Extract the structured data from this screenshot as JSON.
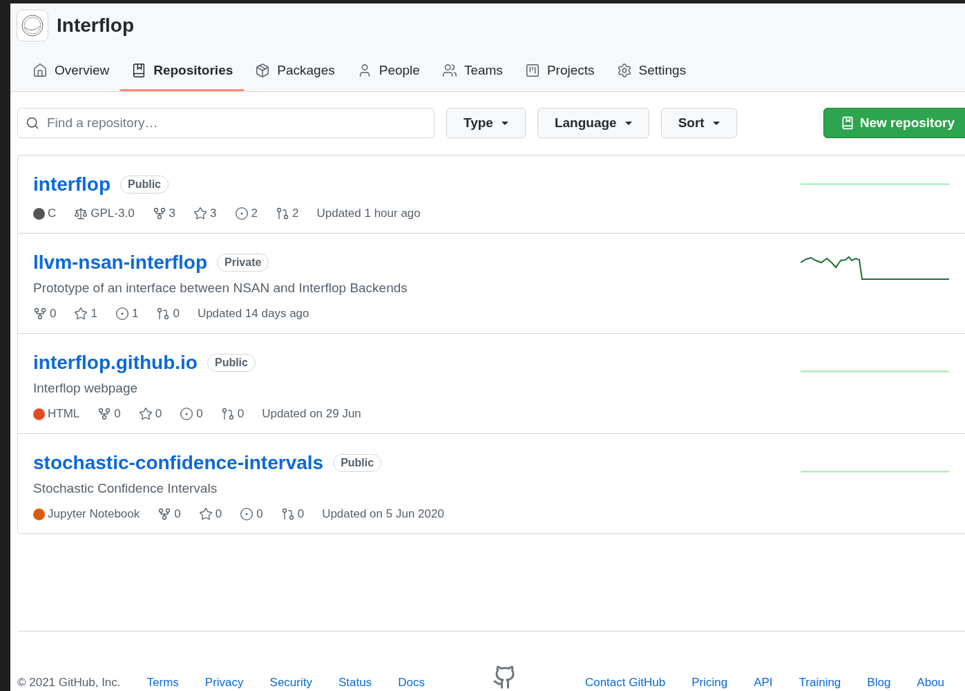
{
  "org": {
    "name": "Interflop"
  },
  "tabs": [
    {
      "label": "Overview",
      "selected": false
    },
    {
      "label": "Repositories",
      "selected": true
    },
    {
      "label": "Packages",
      "selected": false
    },
    {
      "label": "People",
      "selected": false
    },
    {
      "label": "Teams",
      "selected": false
    },
    {
      "label": "Projects",
      "selected": false
    },
    {
      "label": "Settings",
      "selected": false
    }
  ],
  "search": {
    "placeholder": "Find a repository…"
  },
  "filters": [
    {
      "label": "Type"
    },
    {
      "label": "Language"
    },
    {
      "label": "Sort"
    }
  ],
  "new_button": {
    "label": "New repository"
  },
  "repos": [
    {
      "name": "interflop",
      "visibility": "Public",
      "stats": [
        {
          "kind": "language",
          "text": "C",
          "color": "#555555"
        },
        {
          "kind": "license",
          "text": "GPL-3.0"
        },
        {
          "kind": "forks",
          "text": "3"
        },
        {
          "kind": "stars",
          "text": "3"
        },
        {
          "kind": "issues",
          "text": "2"
        },
        {
          "kind": "pulls",
          "text": "2"
        },
        {
          "kind": "updated",
          "text": "Updated 1 hour ago"
        }
      ]
    },
    {
      "name": "llvm-nsan-interflop",
      "visibility": "Private",
      "description": "Prototype of an interface between NSAN and Interflop Backends",
      "stats": [
        {
          "kind": "forks",
          "text": "0"
        },
        {
          "kind": "stars",
          "text": "1"
        },
        {
          "kind": "issues",
          "text": "1"
        },
        {
          "kind": "pulls",
          "text": "0"
        },
        {
          "kind": "updated",
          "text": "Updated 14 days ago"
        }
      ]
    },
    {
      "name": "interflop.github.io",
      "visibility": "Public",
      "description": "Interflop webpage",
      "stats": [
        {
          "kind": "language",
          "text": "HTML",
          "color": "#e34c26"
        },
        {
          "kind": "forks",
          "text": "0"
        },
        {
          "kind": "stars",
          "text": "0"
        },
        {
          "kind": "issues",
          "text": "0"
        },
        {
          "kind": "pulls",
          "text": "0"
        },
        {
          "kind": "updated",
          "text": "Updated on 29 Jun"
        }
      ]
    },
    {
      "name": "stochastic-confidence-intervals",
      "visibility": "Public",
      "description": "Stochastic Confidence Intervals",
      "stats": [
        {
          "kind": "language",
          "text": "Jupyter Notebook",
          "color": "#da5b0b"
        },
        {
          "kind": "forks",
          "text": "0"
        },
        {
          "kind": "stars",
          "text": "0"
        },
        {
          "kind": "issues",
          "text": "0"
        },
        {
          "kind": "pulls",
          "text": "0"
        },
        {
          "kind": "updated",
          "text": "Updated on 5 Jun 2020"
        }
      ]
    }
  ],
  "footer": {
    "copyright": "© 2021 GitHub, Inc.",
    "left_links": [
      "Terms",
      "Privacy",
      "Security",
      "Status",
      "Docs"
    ],
    "right_links": [
      "Contact GitHub",
      "Pricing",
      "API",
      "Training",
      "Blog",
      "Abou"
    ]
  }
}
